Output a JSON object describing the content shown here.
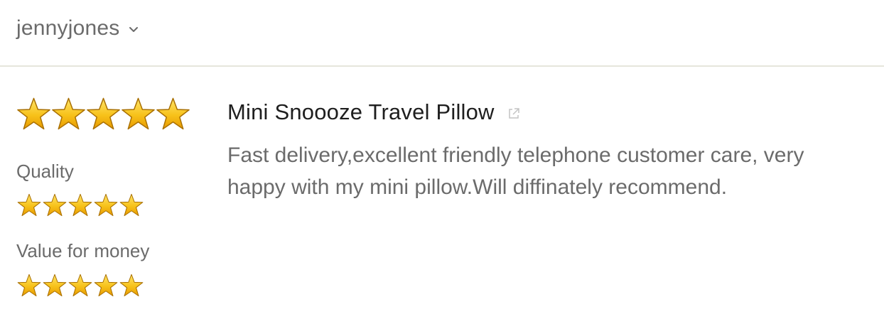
{
  "header": {
    "username": "jennyjones",
    "dropdown_icon": "chevron-down-icon"
  },
  "ratings": {
    "overall_stars": 5,
    "overall_max": 5,
    "quality_label": "Quality",
    "quality_stars": 5,
    "value_label": "Value for money",
    "value_stars": 5,
    "star_color": "#f5b800"
  },
  "review": {
    "product_title": "Mini Snoooze Travel Pillow",
    "external_link_icon": "external-link-icon",
    "text": "Fast delivery,excellent friendly telephone customer care, very happy with my mini pillow.Will diffinately recommend."
  }
}
